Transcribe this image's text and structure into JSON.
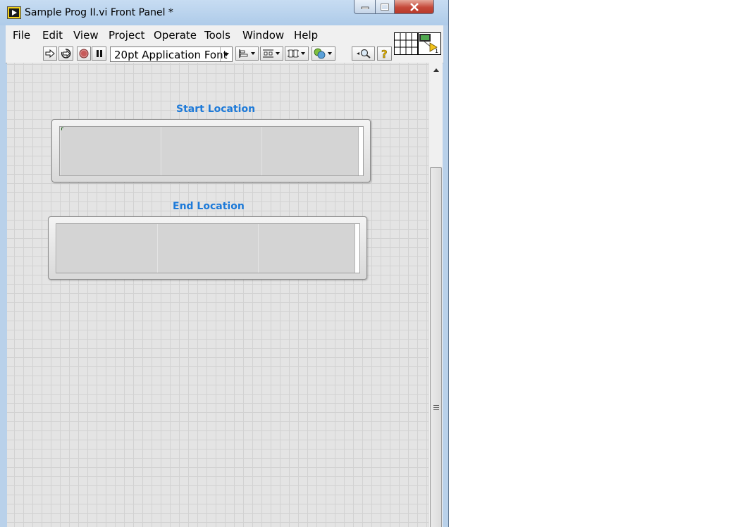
{
  "window": {
    "title": "Sample Prog II.vi Front Panel *"
  },
  "menu": [
    "File",
    "Edit",
    "View",
    "Project",
    "Operate",
    "Tools",
    "Window",
    "Help"
  ],
  "toolbar": {
    "font": "20pt Application Font"
  },
  "connector_pane": {
    "terminal": "1"
  },
  "controls": {
    "start": {
      "label": "Start Location",
      "value": ""
    },
    "end": {
      "label": "End Location",
      "value": ""
    }
  }
}
